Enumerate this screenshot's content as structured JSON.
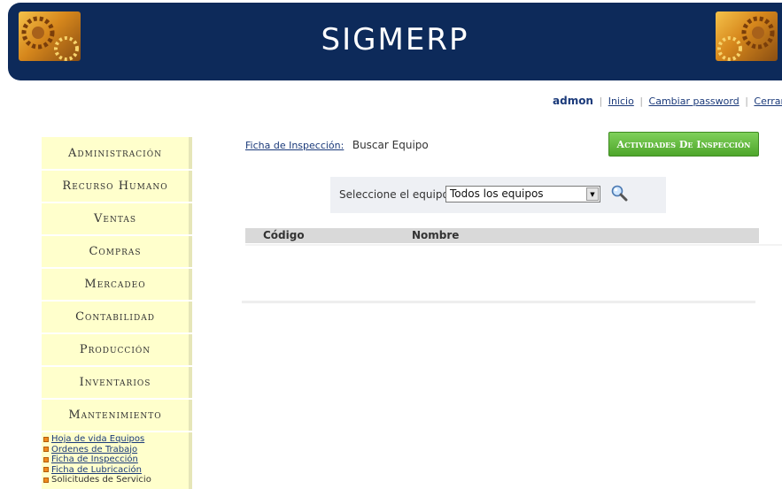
{
  "header": {
    "app_title": "SIGMERP",
    "brand_color": "#0d2a5a"
  },
  "userbar": {
    "username": "admon",
    "links": [
      "Inicio",
      "Cambiar password",
      "Cerrar Sesión"
    ],
    "separator": "|"
  },
  "sidebar": {
    "items": [
      {
        "label": "Administración"
      },
      {
        "label": "Recurso Humano"
      },
      {
        "label": "Ventas"
      },
      {
        "label": "Compras"
      },
      {
        "label": "Mercadeo"
      },
      {
        "label": "Contabilidad"
      },
      {
        "label": "Producción"
      },
      {
        "label": "Inventarios"
      },
      {
        "label": "Mantenimiento"
      }
    ],
    "submenu": [
      "Hoja de vida Equipos",
      "Ordenes de Trabajo",
      "Ficha de Inspección",
      "Ficha de Lubricación",
      "Solicitudes de Servicio"
    ]
  },
  "main": {
    "breadcrumb_link": "Ficha de Inspección:",
    "breadcrumb_current": "Buscar Equipo",
    "action_button": "Actividades De Inspección",
    "filter": {
      "label": "Seleccione el equipo:",
      "selected": "Todos los equipos",
      "search_icon": "magnifier-icon"
    },
    "table": {
      "columns": [
        "Código",
        "Nombre"
      ]
    },
    "accent_color": "#5ab534"
  }
}
